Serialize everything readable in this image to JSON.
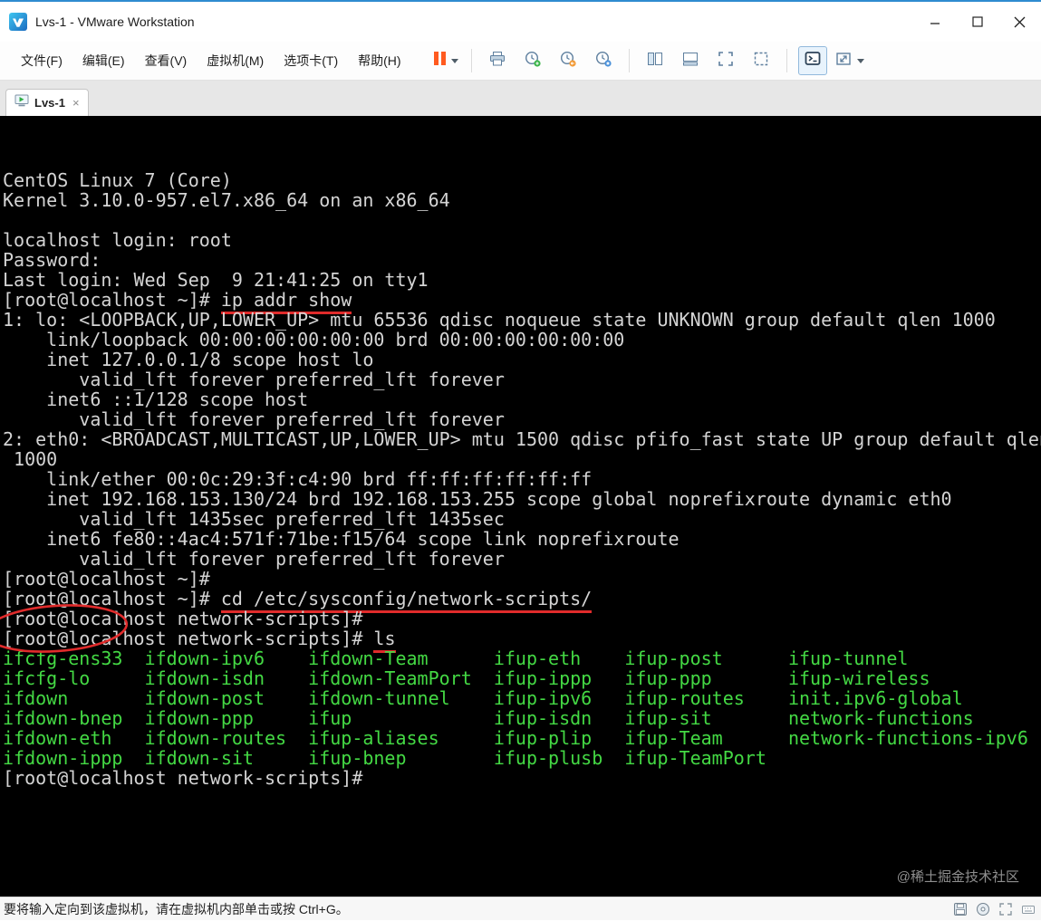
{
  "window": {
    "title": "Lvs-1 - VMware Workstation"
  },
  "menubar": {
    "items": [
      {
        "key": "file",
        "label": "文件(F)"
      },
      {
        "key": "edit",
        "label": "编辑(E)"
      },
      {
        "key": "view",
        "label": "查看(V)"
      },
      {
        "key": "vm",
        "label": "虚拟机(M)"
      },
      {
        "key": "tabs",
        "label": "选项卡(T)"
      },
      {
        "key": "help",
        "label": "帮助(H)"
      }
    ]
  },
  "toolbar": {
    "icons": [
      "pause-icon",
      "chevron-down-icon",
      "send-ctrl-alt-del-icon",
      "take-snapshot-icon",
      "revert-snapshot-icon",
      "manage-snapshots-icon",
      "show-library-icon",
      "show-thumbnail-bar-icon",
      "fullscreen-icon",
      "unity-icon",
      "console-view-icon",
      "fit-guest-icon",
      "chevron-down-icon"
    ]
  },
  "tab": {
    "label": "Lvs-1",
    "close": "×"
  },
  "terminal": {
    "colors": {
      "background": "#000000",
      "text": "#d4d4d4",
      "executable_green": "#44d944",
      "annotation_red": "#e02b2b"
    },
    "lines": [
      [
        {
          "t": "CentOS Linux 7 (Core)"
        }
      ],
      [
        {
          "t": "Kernel 3.10.0-957.el7.x86_64 on an x86_64"
        }
      ],
      [
        {
          "t": ""
        }
      ],
      [
        {
          "t": "localhost login: root"
        }
      ],
      [
        {
          "t": "Password:"
        }
      ],
      [
        {
          "t": "Last login: Wed Sep  9 21:41:25 on tty1"
        }
      ],
      [
        {
          "t": "[root@localhost ~]# "
        },
        {
          "t": "ip addr show",
          "c": "ru"
        }
      ],
      [
        {
          "t": "1: lo: <LOOPBACK,UP,LOWER_UP> mtu 65536 qdisc noqueue state UNKNOWN group default qlen 1000"
        }
      ],
      [
        {
          "t": "    link/loopback 00:00:00:00:00:00 brd 00:00:00:00:00:00"
        }
      ],
      [
        {
          "t": "    inet 127.0.0.1/8 scope host lo"
        }
      ],
      [
        {
          "t": "       valid_lft forever preferred_lft forever"
        }
      ],
      [
        {
          "t": "    inet6 ::1/128 scope host"
        }
      ],
      [
        {
          "t": "       valid_lft forever preferred_lft forever"
        }
      ],
      [
        {
          "t": "2: eth0: <BROADCAST,MULTICAST,UP,LOWER_UP> mtu 1500 qdisc pfifo_fast state UP group default qlen"
        }
      ],
      [
        {
          "t": " 1000"
        }
      ],
      [
        {
          "t": "    link/ether 00:0c:29:3f:c4:90 brd ff:ff:ff:ff:ff:ff"
        }
      ],
      [
        {
          "t": "    inet 192.168.153.130/24 brd 192.168.153.255 scope global noprefixroute dynamic eth0"
        }
      ],
      [
        {
          "t": "       valid_lft 1435sec preferred_lft 1435sec"
        }
      ],
      [
        {
          "t": "    inet6 fe80::4ac4:571f:71be:f15/64 scope link noprefixroute"
        }
      ],
      [
        {
          "t": "       valid_lft forever preferred_lft forever"
        }
      ],
      [
        {
          "t": "[root@localhost ~]#"
        }
      ],
      [
        {
          "t": "[root@localhost ~]# "
        },
        {
          "t": "cd /etc/sysconfig/network-scripts/",
          "c": "ru"
        }
      ],
      [
        {
          "t": "[root@localhost network-scripts]#"
        }
      ],
      [
        {
          "t": "[root@localhost network-scripts]# "
        },
        {
          "t": "ls",
          "c": "ru"
        }
      ],
      [
        {
          "t": "ifcfg-ens33  ifdown-ipv6    ifdown-Team      ifup-eth    ifup-post      ifup-tunnel",
          "c": "g"
        }
      ],
      [
        {
          "t": "ifcfg-lo     ifdown-isdn    ifdown-TeamPort  ifup-ippp   ifup-ppp       ifup-wireless",
          "c": "g"
        }
      ],
      [
        {
          "t": "ifdown       ifdown-post    ifdown-tunnel    ifup-ipv6   ifup-routes    init.ipv6-global",
          "c": "g"
        }
      ],
      [
        {
          "t": "ifdown-bnep  ifdown-ppp     ifup             ifup-isdn   ifup-sit       network-functions",
          "c": "g"
        }
      ],
      [
        {
          "t": "ifdown-eth   ifdown-routes  ifup-aliases     ifup-plip   ifup-Team      network-functions-ipv6",
          "c": "g"
        }
      ],
      [
        {
          "t": "ifdown-ippp  ifdown-sit     ifup-bnep        ifup-plusb  ifup-TeamPort",
          "c": "g"
        }
      ],
      [
        {
          "t": "[root@localhost network-scripts]#"
        }
      ]
    ]
  },
  "annotations": {
    "underlined_commands": [
      "ip addr show",
      "cd /etc/sysconfig/network-scripts/",
      "ls"
    ],
    "circled_files": [
      "ifcfg-ens33",
      "ifcfg-lo"
    ],
    "color": "#e02b2b"
  },
  "watermark": "@稀土掘金技术社区",
  "statusbar": {
    "message": "要将输入定向到该虚拟机，请在虚拟机内部单击或按 Ctrl+G。"
  }
}
